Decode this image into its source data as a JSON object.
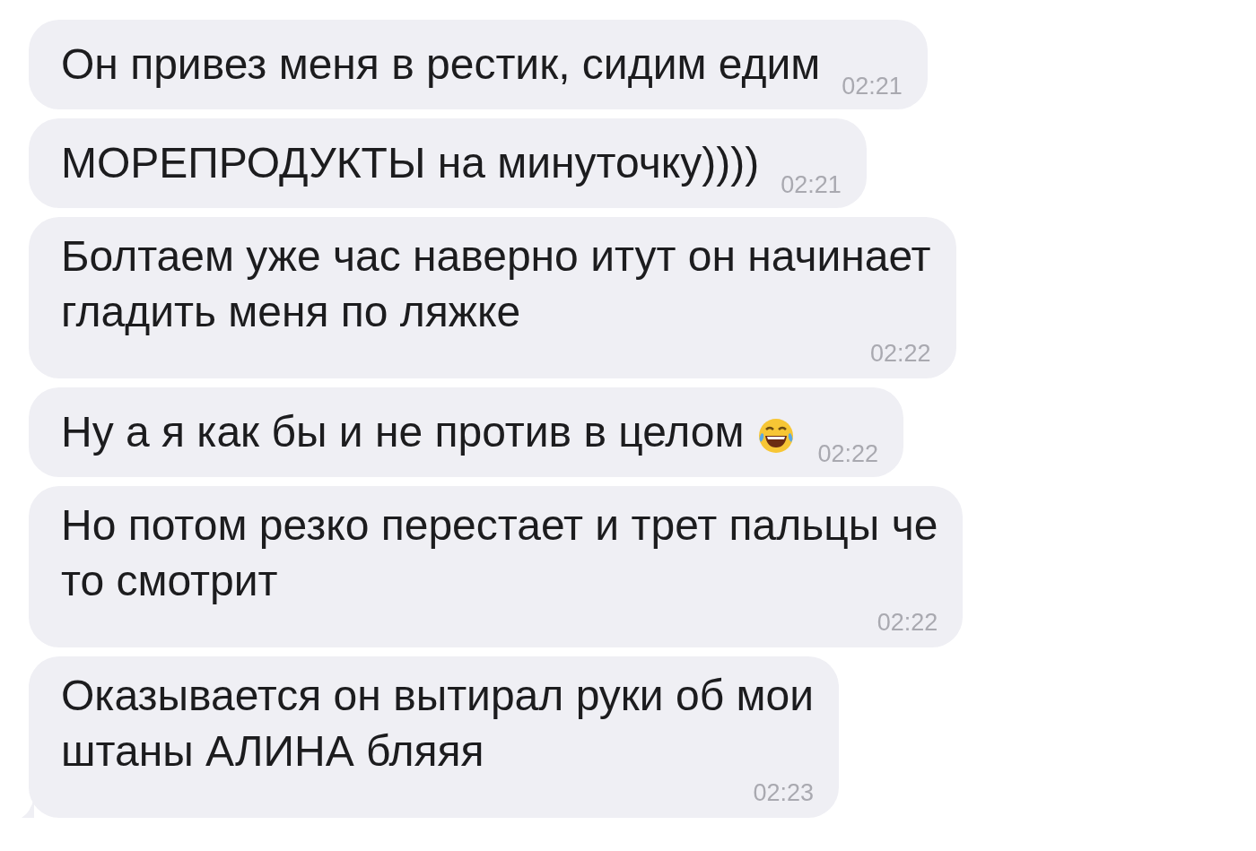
{
  "messages": [
    {
      "kind": "inline",
      "text": "Он привез меня в рестик, сидим едим",
      "time": "02:21",
      "emoji": false,
      "tail": false
    },
    {
      "kind": "inline",
      "text": "МОРЕПРОДУКТЫ на минуточку))))",
      "time": "02:21",
      "emoji": false,
      "tail": false
    },
    {
      "kind": "wrapped",
      "text": "Болтаем уже час наверно итут он начинает\nгладить меня по ляжке",
      "time": "02:22",
      "emoji": false,
      "tail": false
    },
    {
      "kind": "inline",
      "text": "Ну а я как бы и не против в целом",
      "time": "02:22",
      "emoji": true,
      "tail": false
    },
    {
      "kind": "wrapped",
      "text": "Но потом резко перестает и трет пальцы че\nто смотрит",
      "time": "02:22",
      "emoji": false,
      "tail": false
    },
    {
      "kind": "wrapped",
      "text": "Оказывается он вытирал руки об мои\nштаны АЛИНА бляяя",
      "time": "02:23",
      "emoji": false,
      "tail": true
    }
  ]
}
